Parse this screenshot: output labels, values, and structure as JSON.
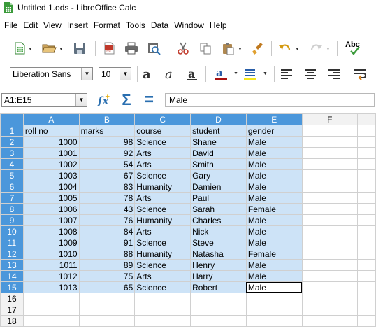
{
  "window": {
    "title": "Untitled 1.ods - LibreOffice Calc"
  },
  "menu": [
    {
      "label": "File"
    },
    {
      "label": "Edit"
    },
    {
      "label": "View"
    },
    {
      "label": "Insert"
    },
    {
      "label": "Format"
    },
    {
      "label": "Tools"
    },
    {
      "label": "Data"
    },
    {
      "label": "Window"
    },
    {
      "label": "Help"
    }
  ],
  "toolbar": {
    "spellcheck_label": "Abc"
  },
  "format": {
    "font_name": "Liberation Sans",
    "font_size": "10"
  },
  "formula_bar": {
    "name_box": "A1:E15",
    "content": "Male",
    "sigma": "Σ",
    "equals": "="
  },
  "sheet": {
    "columns": [
      "A",
      "B",
      "C",
      "D",
      "E",
      "F"
    ],
    "headers": [
      "roll no",
      "marks",
      "course",
      "student",
      "gender"
    ],
    "rows": [
      [
        "1000",
        "98",
        "Science",
        "Shane",
        "Male"
      ],
      [
        "1001",
        "92",
        "Arts",
        "David",
        "Male"
      ],
      [
        "1002",
        "54",
        "Arts",
        "Smith",
        "Male"
      ],
      [
        "1003",
        "67",
        "Science",
        "Gary",
        "Male"
      ],
      [
        "1004",
        "83",
        "Humanity",
        "Damien",
        "Male"
      ],
      [
        "1005",
        "78",
        "Arts",
        "Paul",
        "Male"
      ],
      [
        "1006",
        "43",
        "Science",
        "Sarah",
        "Female"
      ],
      [
        "1007",
        "76",
        "Humanity",
        "Charles",
        "Male"
      ],
      [
        "1008",
        "84",
        "Arts",
        "Nick",
        "Male"
      ],
      [
        "1009",
        "91",
        "Science",
        "Steve",
        "Male"
      ],
      [
        "1010",
        "88",
        "Humanity",
        "Natasha",
        "Female"
      ],
      [
        "1011",
        "89",
        "Science",
        "Henry",
        "Male"
      ],
      [
        "1012",
        "75",
        "Arts",
        "Harry",
        "Male"
      ],
      [
        "1013",
        "65",
        "Science",
        "Robert",
        "Male"
      ]
    ],
    "row_numbers": [
      "1",
      "2",
      "3",
      "4",
      "5",
      "6",
      "7",
      "8",
      "9",
      "10",
      "11",
      "12",
      "13",
      "14",
      "15",
      "16",
      "17",
      "18"
    ]
  },
  "colors": {
    "selection_header": "#4b97db",
    "selection_fill": "#cde3f7"
  }
}
